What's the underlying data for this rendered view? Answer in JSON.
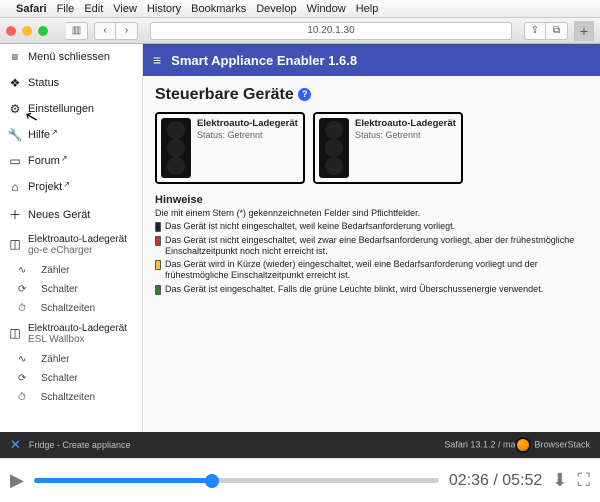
{
  "menubar": {
    "app": "Safari",
    "items": [
      "File",
      "Edit",
      "View",
      "History",
      "Bookmarks",
      "Develop",
      "Window",
      "Help"
    ]
  },
  "browser": {
    "url": "10.20.1.30"
  },
  "sidebar": {
    "close": "Menü schliessen",
    "items": [
      {
        "icon": "❖",
        "label": "Status"
      },
      {
        "icon": "⚙",
        "label": "Einstellungen"
      },
      {
        "icon": "🔧",
        "label": "Hilfe",
        "ext": true
      },
      {
        "icon": "▭",
        "label": "Forum",
        "ext": true
      },
      {
        "icon": "⌂",
        "label": "Projekt",
        "ext": true
      },
      {
        "icon": "＋",
        "label": "Neues Gerät"
      }
    ],
    "devices": [
      {
        "name": "Elektroauto-Ladegerät",
        "sub": "go-e eCharger",
        "children": [
          "Zähler",
          "Schalter",
          "Schaltzeiten"
        ]
      },
      {
        "name": "Elektroauto-Ladegerät",
        "sub": "ESL Wallbox",
        "children": [
          "Zähler",
          "Schalter",
          "Schaltzeiten"
        ]
      }
    ],
    "sub_icons": [
      "∿",
      "⟳",
      "⏱"
    ]
  },
  "app": {
    "title": "Smart Appliance Enabler 1.6.8"
  },
  "page": {
    "heading": "Steuerbare Geräte",
    "cards": [
      {
        "title": "Elektroauto-Ladegerät",
        "status_label": "Status:",
        "status": "Getrennt"
      },
      {
        "title": "Elektroauto-Ladegerät",
        "status_label": "Status:",
        "status": "Getrennt"
      }
    ],
    "hints_title": "Hinweise",
    "hints_intro": "Die mit einem Stern (*) gekennzeichneten Felder sind Pflichtfelder.",
    "hints": [
      {
        "color": "off",
        "text": "Das Gerät ist nicht eingeschaltet, weil keine Bedarfsanforderung vorliegt."
      },
      {
        "color": "red",
        "text": "Das Gerät ist nicht eingeschaltet, weil zwar eine Bedarfsanforderung vorliegt, aber der frühestmögliche Einschaltzeitpunkt noch nicht erreicht ist."
      },
      {
        "color": "yel",
        "text": "Das Gerät wird in Kürze (wieder) eingeschaltet, weil eine Bedarfsanforderung vorliegt und der frühestmögliche Einschaltzeitpunkt erreicht ist."
      },
      {
        "color": "grn",
        "text": "Das Gerät ist eingeschaltet. Falls die grüne Leuchte blinkt, wird Überschussenergie verwendet."
      }
    ]
  },
  "footer": {
    "left": "Fridge - Create appliance",
    "right_prefix": "Safari 13.1.2 / ma",
    "right_brand": "BrowserStack"
  },
  "video": {
    "current": "02:36",
    "duration": "05:52",
    "progress_pct": 44
  }
}
